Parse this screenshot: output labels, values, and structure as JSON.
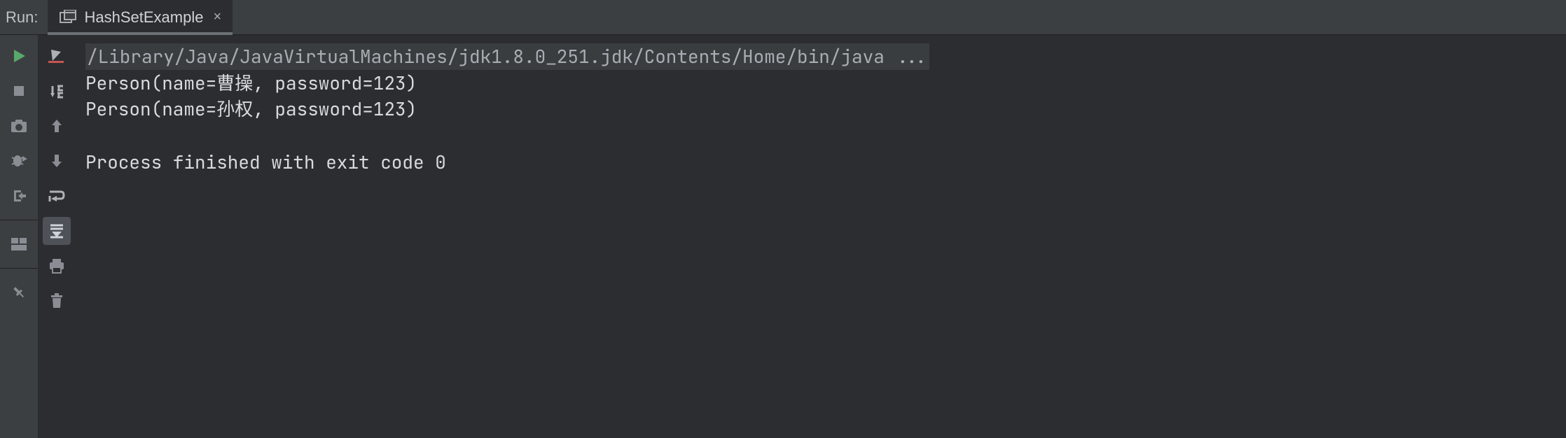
{
  "tabbar": {
    "run_label": "Run:",
    "tab_title": "HashSetExample",
    "tab_close": "×"
  },
  "console": {
    "command_line": "/Library/Java/JavaVirtualMachines/jdk1.8.0_251.jdk/Contents/Home/bin/java ...",
    "lines": [
      "Person(name=曹操, password=123)",
      "Person(name=孙权, password=123)",
      "",
      "Process finished with exit code 0"
    ]
  },
  "icons": {
    "left_gutter": [
      "rerun",
      "stop",
      "camera",
      "debug-exit",
      "exit",
      "layout",
      "pin"
    ],
    "inner_gutter": [
      "edit-run",
      "step",
      "up",
      "down",
      "wrap",
      "scroll-to-end",
      "print",
      "trash"
    ]
  }
}
